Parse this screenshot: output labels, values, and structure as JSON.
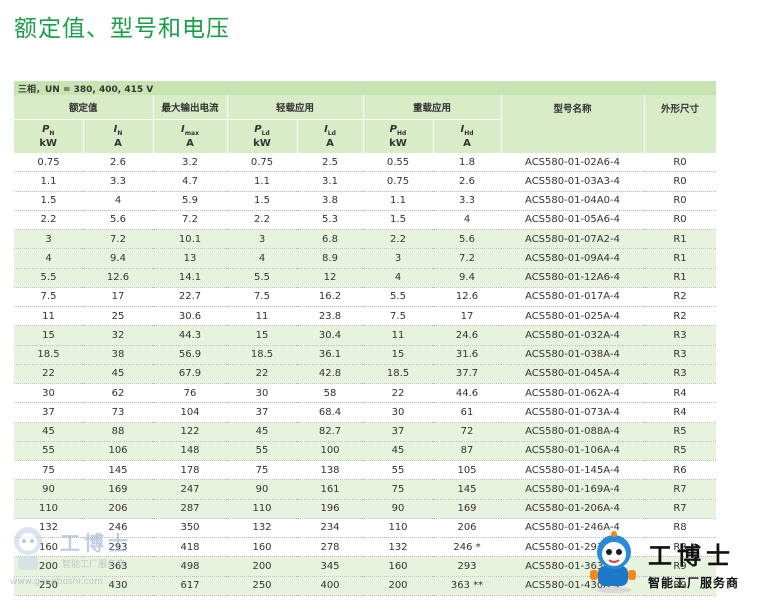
{
  "page": {
    "title": "额定值、型号和电压"
  },
  "table": {
    "condition": "三相，UN = 380, 400, 415 V",
    "groups": {
      "rated": "额定值",
      "max_current": "最大输出电流",
      "light_duty": "轻载应用",
      "heavy_duty": "重载应用",
      "type_name": "型号名称",
      "frame_size": "外形尺寸"
    },
    "symbols": {
      "pn": {
        "sym": "P",
        "sub": "N",
        "unit": "kW"
      },
      "in": {
        "sym": "I",
        "sub": "N",
        "unit": "A"
      },
      "imax": {
        "sym": "I",
        "sub": "max",
        "unit": "A"
      },
      "pld": {
        "sym": "P",
        "sub": "Ld",
        "unit": "kW"
      },
      "ild": {
        "sym": "I",
        "sub": "Ld",
        "unit": "A"
      },
      "phd": {
        "sym": "P",
        "sub": "Hd",
        "unit": "kW"
      },
      "ihd": {
        "sym": "I",
        "sub": "Hd",
        "unit": "A"
      }
    },
    "rows": [
      [
        "0.75",
        "2.6",
        "3.2",
        "0.75",
        "2.5",
        "0.55",
        "1.8",
        "ACS580-01-02A6-4",
        "R0"
      ],
      [
        "1.1",
        "3.3",
        "4.7",
        "1.1",
        "3.1",
        "0.75",
        "2.6",
        "ACS580-01-03A3-4",
        "R0"
      ],
      [
        "1.5",
        "4",
        "5.9",
        "1.5",
        "3.8",
        "1.1",
        "3.3",
        "ACS580-01-04A0-4",
        "R0"
      ],
      [
        "2.2",
        "5.6",
        "7.2",
        "2.2",
        "5.3",
        "1.5",
        "4",
        "ACS580-01-05A6-4",
        "R0"
      ],
      [
        "3",
        "7.2",
        "10.1",
        "3",
        "6.8",
        "2.2",
        "5.6",
        "ACS580-01-07A2-4",
        "R1"
      ],
      [
        "4",
        "9.4",
        "13",
        "4",
        "8.9",
        "3",
        "7.2",
        "ACS580-01-09A4-4",
        "R1"
      ],
      [
        "5.5",
        "12.6",
        "14.1",
        "5.5",
        "12",
        "4",
        "9.4",
        "ACS580-01-12A6-4",
        "R1"
      ],
      [
        "7.5",
        "17",
        "22.7",
        "7.5",
        "16.2",
        "5.5",
        "12.6",
        "ACS580-01-017A-4",
        "R2"
      ],
      [
        "11",
        "25",
        "30.6",
        "11",
        "23.8",
        "7.5",
        "17",
        "ACS580-01-025A-4",
        "R2"
      ],
      [
        "15",
        "32",
        "44.3",
        "15",
        "30.4",
        "11",
        "24.6",
        "ACS580-01-032A-4",
        "R3"
      ],
      [
        "18.5",
        "38",
        "56.9",
        "18.5",
        "36.1",
        "15",
        "31.6",
        "ACS580-01-038A-4",
        "R3"
      ],
      [
        "22",
        "45",
        "67.9",
        "22",
        "42.8",
        "18.5",
        "37.7",
        "ACS580-01-045A-4",
        "R3"
      ],
      [
        "30",
        "62",
        "76",
        "30",
        "58",
        "22",
        "44.6",
        "ACS580-01-062A-4",
        "R4"
      ],
      [
        "37",
        "73",
        "104",
        "37",
        "68.4",
        "30",
        "61",
        "ACS580-01-073A-4",
        "R4"
      ],
      [
        "45",
        "88",
        "122",
        "45",
        "82.7",
        "37",
        "72",
        "ACS580-01-088A-4",
        "R5"
      ],
      [
        "55",
        "106",
        "148",
        "55",
        "100",
        "45",
        "87",
        "ACS580-01-106A-4",
        "R5"
      ],
      [
        "75",
        "145",
        "178",
        "75",
        "138",
        "55",
        "105",
        "ACS580-01-145A-4",
        "R6"
      ],
      [
        "90",
        "169",
        "247",
        "90",
        "161",
        "75",
        "145",
        "ACS580-01-169A-4",
        "R7"
      ],
      [
        "110",
        "206",
        "287",
        "110",
        "196",
        "90",
        "169",
        "ACS580-01-206A-4",
        "R7"
      ],
      [
        "132",
        "246",
        "350",
        "132",
        "234",
        "110",
        "206",
        "ACS580-01-246A-4",
        "R8"
      ],
      [
        "160",
        "293",
        "418",
        "160",
        "278",
        "132",
        "246 *",
        "ACS580-01-293A-4",
        "R8"
      ],
      [
        "200",
        "363",
        "498",
        "200",
        "345",
        "160",
        "293",
        "ACS580-01-363A-4",
        "R9"
      ],
      [
        "250",
        "430",
        "617",
        "250",
        "400",
        "200",
        "363 **",
        "ACS580-01-430A-4",
        "R9"
      ]
    ],
    "shaded_rows": [
      4,
      5,
      6,
      9,
      10,
      11,
      14,
      15,
      17,
      18,
      21,
      22
    ]
  },
  "watermarks": {
    "left": {
      "title": "工博士",
      "subtitle": "智能工厂服务商",
      "url": "www.gongboshi.com"
    },
    "right": {
      "title": "工博士",
      "subtitle": "智能工厂服务商"
    }
  },
  "colors": {
    "title_green": "#1a9e4a",
    "header_bg": "#d8ecc8",
    "shade_bg": "#e7f3dc"
  }
}
